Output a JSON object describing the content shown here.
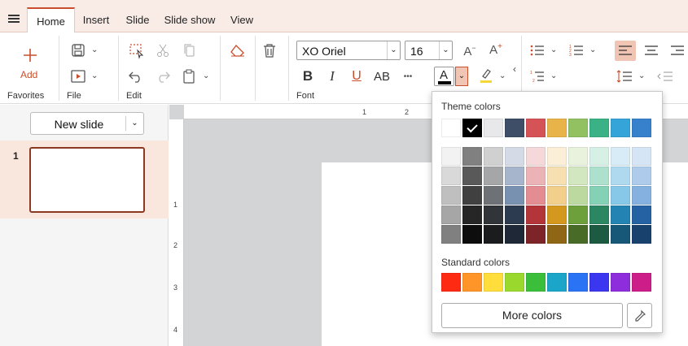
{
  "tabs": [
    {
      "label": "Home",
      "active": true
    },
    {
      "label": "Insert",
      "active": false
    },
    {
      "label": "Slide",
      "active": false
    },
    {
      "label": "Slide show",
      "active": false
    },
    {
      "label": "View",
      "active": false
    }
  ],
  "ribbon": {
    "favorites": {
      "add_label": "Add",
      "group_label": "Favorites"
    },
    "file": {
      "group_label": "File"
    },
    "edit": {
      "group_label": "Edit"
    },
    "font": {
      "group_label": "Font",
      "font_name": "XO Oriel",
      "font_size": "16",
      "case_label": "AB",
      "more": "•••"
    }
  },
  "left_panel": {
    "new_slide_label": "New slide",
    "slides": [
      {
        "number": "1"
      }
    ]
  },
  "rulers": {
    "horizontal": [
      "1",
      "2"
    ],
    "vertical": [
      "1",
      "2",
      "3",
      "4"
    ]
  },
  "color_popup": {
    "theme_title": "Theme colors",
    "standard_title": "Standard colors",
    "more_colors_label": "More colors",
    "theme_top": [
      "#ffffff",
      "#000000",
      "#e8e8ea",
      "#3d4e66",
      "#d55257",
      "#e8b348",
      "#91c160",
      "#3ab286",
      "#35a4d8",
      "#3680cc"
    ],
    "selected_index": 1,
    "theme_shades": [
      [
        "#f2f2f2",
        "#808080",
        "#d0d0d0",
        "#d4dbe6",
        "#f4d8da",
        "#fbefd8",
        "#e8f2dd",
        "#d6f0e6",
        "#d7ecf7",
        "#d6e5f5"
      ],
      [
        "#d9d9d9",
        "#595959",
        "#a5a6a8",
        "#a6b5cc",
        "#ebb3b6",
        "#f6e0b1",
        "#d2e6bf",
        "#ade1ce",
        "#afd9ef",
        "#aecbeb"
      ],
      [
        "#bfbfbf",
        "#404040",
        "#6e7176",
        "#7891b0",
        "#e38d92",
        "#f2d08b",
        "#bcda9f",
        "#85d1b5",
        "#87c8e8",
        "#85b1e0"
      ],
      [
        "#a6a6a6",
        "#262626",
        "#313438",
        "#2c3b4f",
        "#b3353a",
        "#d4981f",
        "#6da03b",
        "#2a8762",
        "#2384b3",
        "#2562a4"
      ],
      [
        "#808080",
        "#0d0d0d",
        "#1b1c1e",
        "#1e2836",
        "#7c2428",
        "#8f6615",
        "#496b28",
        "#1c5a41",
        "#175878",
        "#19416e"
      ]
    ],
    "standard": [
      "#ff2a12",
      "#ff9529",
      "#ffde3b",
      "#9ad82d",
      "#3bbf3a",
      "#1ba6c9",
      "#2a73f5",
      "#3b37f0",
      "#8e2ddb",
      "#cc1d88"
    ]
  },
  "colors": {
    "accent": "#c94e2c",
    "font_color": "#000000",
    "highlight": "#f5d73a"
  }
}
